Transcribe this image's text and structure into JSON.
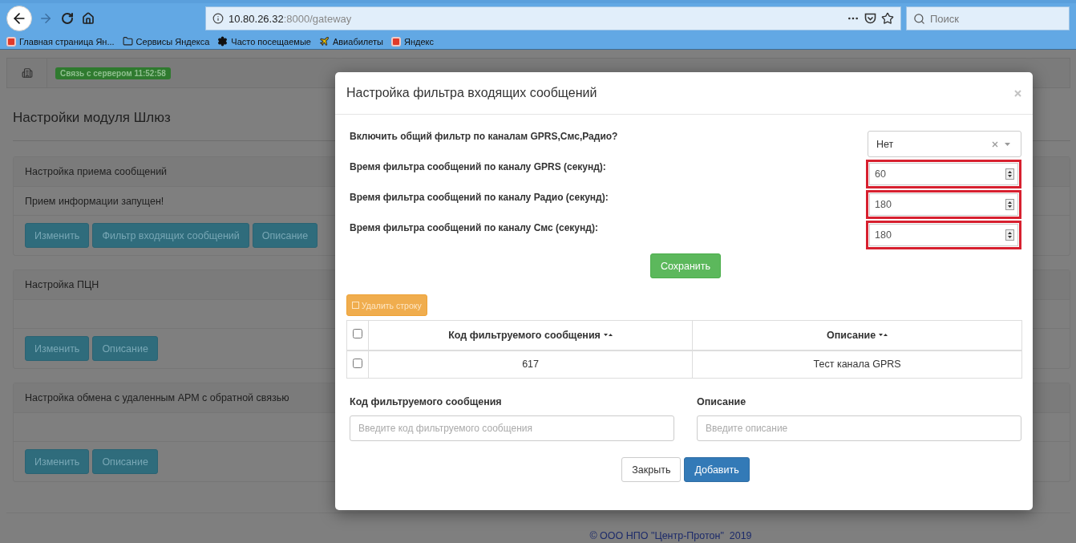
{
  "browser": {
    "url_host": "10.80.26.32",
    "url_path": ":8000/gateway",
    "search_placeholder": "Поиск",
    "bookmarks": [
      {
        "kind": "yandex",
        "label": "Главная страница Ян..."
      },
      {
        "kind": "folder",
        "label": "Сервисы Яндекса"
      },
      {
        "kind": "gear",
        "label": "Часто посещаемые"
      },
      {
        "kind": "plane",
        "label": "Авиабилеты"
      },
      {
        "kind": "yandex",
        "label": "Яндекс"
      }
    ]
  },
  "page": {
    "status_badge": "Связь с сервером 11:52:58",
    "title": "Настройки модуля Шлюз",
    "panels": [
      {
        "title": "Настройка приема сообщений",
        "body": "Прием информации запущен!",
        "buttons": [
          "Изменить",
          "Фильтр входящих сообщений",
          "Описание"
        ]
      },
      {
        "title": "Настройка ПЦН",
        "buttons": [
          "Изменить",
          "Описание"
        ]
      },
      {
        "title": "Настройка обмена с удаленным АРМ с обратной связью",
        "buttons": [
          "Изменить",
          "Описание"
        ]
      }
    ],
    "footer": "© ООО НПО \"Центр-Протон\"  2019"
  },
  "modal": {
    "title": "Настройка фильтра входящих сообщений",
    "settings": [
      {
        "kind": "select",
        "label": "Включить общий фильтр по каналам GPRS,Смс,Радио?",
        "value": "Нет"
      },
      {
        "kind": "number",
        "label": "Время фильтра сообщений по каналу GPRS (секунд):",
        "value": "60",
        "highlighted": true
      },
      {
        "kind": "number",
        "label": "Время фильтра сообщений по каналу Радио (секунд):",
        "value": "180",
        "highlighted": true
      },
      {
        "kind": "number",
        "label": "Время фильтра сообщений по каналу Смс (секунд):",
        "value": "180",
        "highlighted": true
      }
    ],
    "save_button": "Сохранить",
    "delete_button": "Удалить строку",
    "table": {
      "all_checked": false,
      "columns": [
        "Код фильтруемого сообщения",
        "Описание"
      ],
      "rows": [
        {
          "checked": false,
          "cells": [
            "617",
            "Тест канала GPRS"
          ]
        }
      ]
    },
    "fields": [
      {
        "label": "Код фильтруемого сообщения",
        "placeholder": "Введите код фильтруемого сообщения"
      },
      {
        "label": "Описание",
        "placeholder": "Введите описание"
      }
    ],
    "buttons": [
      {
        "kind": "default",
        "label": "Закрыть"
      },
      {
        "kind": "primary",
        "label": "Добавить"
      }
    ]
  }
}
